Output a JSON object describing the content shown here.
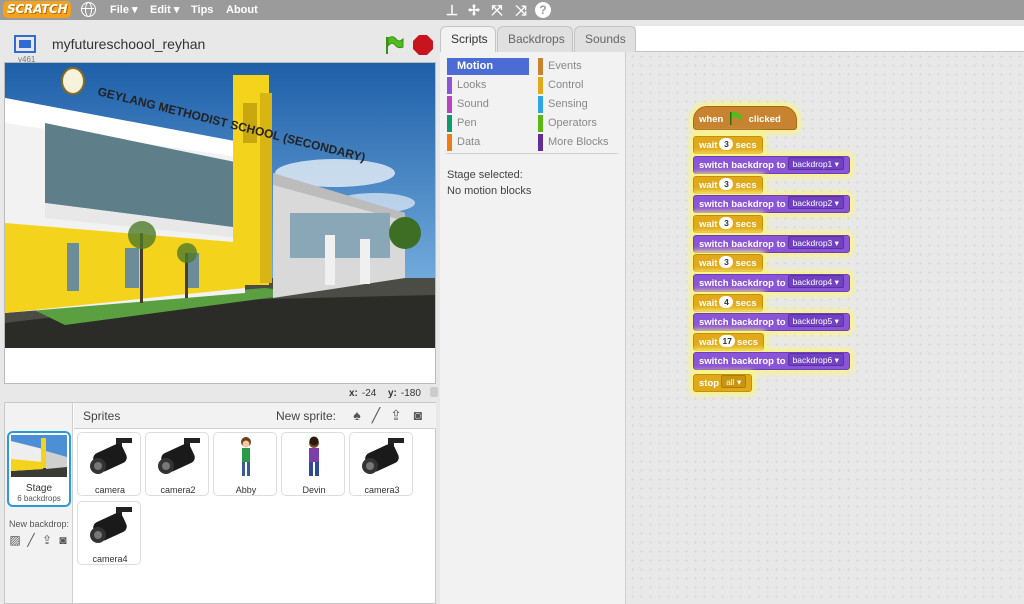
{
  "menubar": {
    "logo": "SCRATCH",
    "items": [
      "File",
      "Edit",
      "Tips",
      "About"
    ]
  },
  "stage": {
    "version": "v461",
    "project_title": "myfutureschoool_reyhan",
    "building_sign": "GEYLANG METHODIST SCHOOL (SECONDARY)",
    "coords": {
      "x_label": "x:",
      "x_value": "-24",
      "y_label": "y:",
      "y_value": "-180"
    }
  },
  "sprite_pane": {
    "title": "Sprites",
    "new_sprite_label": "New sprite:",
    "stage_label": "Stage",
    "stage_backdrops": "6 backdrops",
    "new_backdrop_label": "New backdrop:",
    "sprites": [
      {
        "name": "camera",
        "icon": "camera-icon"
      },
      {
        "name": "camera2",
        "icon": "camera-icon"
      },
      {
        "name": "Abby",
        "icon": "person-icon"
      },
      {
        "name": "Devin",
        "icon": "person-icon"
      },
      {
        "name": "camera3",
        "icon": "camera-icon"
      },
      {
        "name": "camera4",
        "icon": "camera-icon"
      }
    ]
  },
  "tabs": [
    "Scripts",
    "Backdrops",
    "Sounds"
  ],
  "palette": {
    "left": [
      {
        "label": "Motion",
        "color": "#4a6cd4"
      },
      {
        "label": "Looks",
        "color": "#8a55d7"
      },
      {
        "label": "Sound",
        "color": "#bb42c3"
      },
      {
        "label": "Pen",
        "color": "#0e9a6c"
      },
      {
        "label": "Data",
        "color": "#ee7d16"
      }
    ],
    "right": [
      {
        "label": "Events",
        "color": "#c88330"
      },
      {
        "label": "Control",
        "color": "#e1a91a"
      },
      {
        "label": "Sensing",
        "color": "#2ca5e2"
      },
      {
        "label": "Operators",
        "color": "#5cb712"
      },
      {
        "label": "More Blocks",
        "color": "#632d99"
      }
    ],
    "stage_selected": "Stage selected:",
    "no_motion": "No motion blocks"
  },
  "script": {
    "hat": {
      "when": "when",
      "clicked": "clicked"
    },
    "wait_label": "wait",
    "secs_label": "secs",
    "switch_label": "switch backdrop to",
    "steps": [
      {
        "wait": "3",
        "backdrop": "backdrop1"
      },
      {
        "wait": "3",
        "backdrop": "backdrop2"
      },
      {
        "wait": "3",
        "backdrop": "backdrop3"
      },
      {
        "wait": "3",
        "backdrop": "backdrop4"
      },
      {
        "wait": "4",
        "backdrop": "backdrop5"
      },
      {
        "wait": "17",
        "backdrop": "backdrop6"
      }
    ],
    "stop_label": "stop",
    "stop_value": "all"
  },
  "colors": {
    "motion": "#4a6cd4",
    "looks": "#8a55d7",
    "control": "#e1a91a",
    "events": "#c88330",
    "selection": "#2c9ad6"
  }
}
